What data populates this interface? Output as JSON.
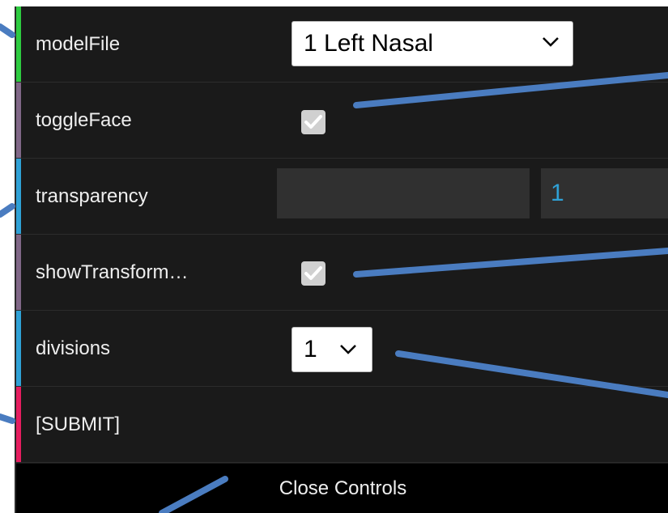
{
  "controls": {
    "modelFile": {
      "label": "modelFile",
      "value": "1 Left Nasal",
      "stripe_color": "#2ecc40"
    },
    "toggleFace": {
      "label": "toggleFace",
      "checked": true,
      "stripe_color": "#806787"
    },
    "transparency": {
      "label": "transparency",
      "value": "1",
      "stripe_color": "#2fa1d6"
    },
    "showTransform": {
      "label": "showTransform…",
      "checked": true,
      "stripe_color": "#806787"
    },
    "divisions": {
      "label": "divisions",
      "value": "1",
      "stripe_color": "#2fa1d6"
    },
    "submit": {
      "label": "[SUBMIT]",
      "stripe_color": "#e61d5f"
    }
  },
  "close_controls_label": "Close Controls",
  "callout_line_color": "#4a7cc0"
}
